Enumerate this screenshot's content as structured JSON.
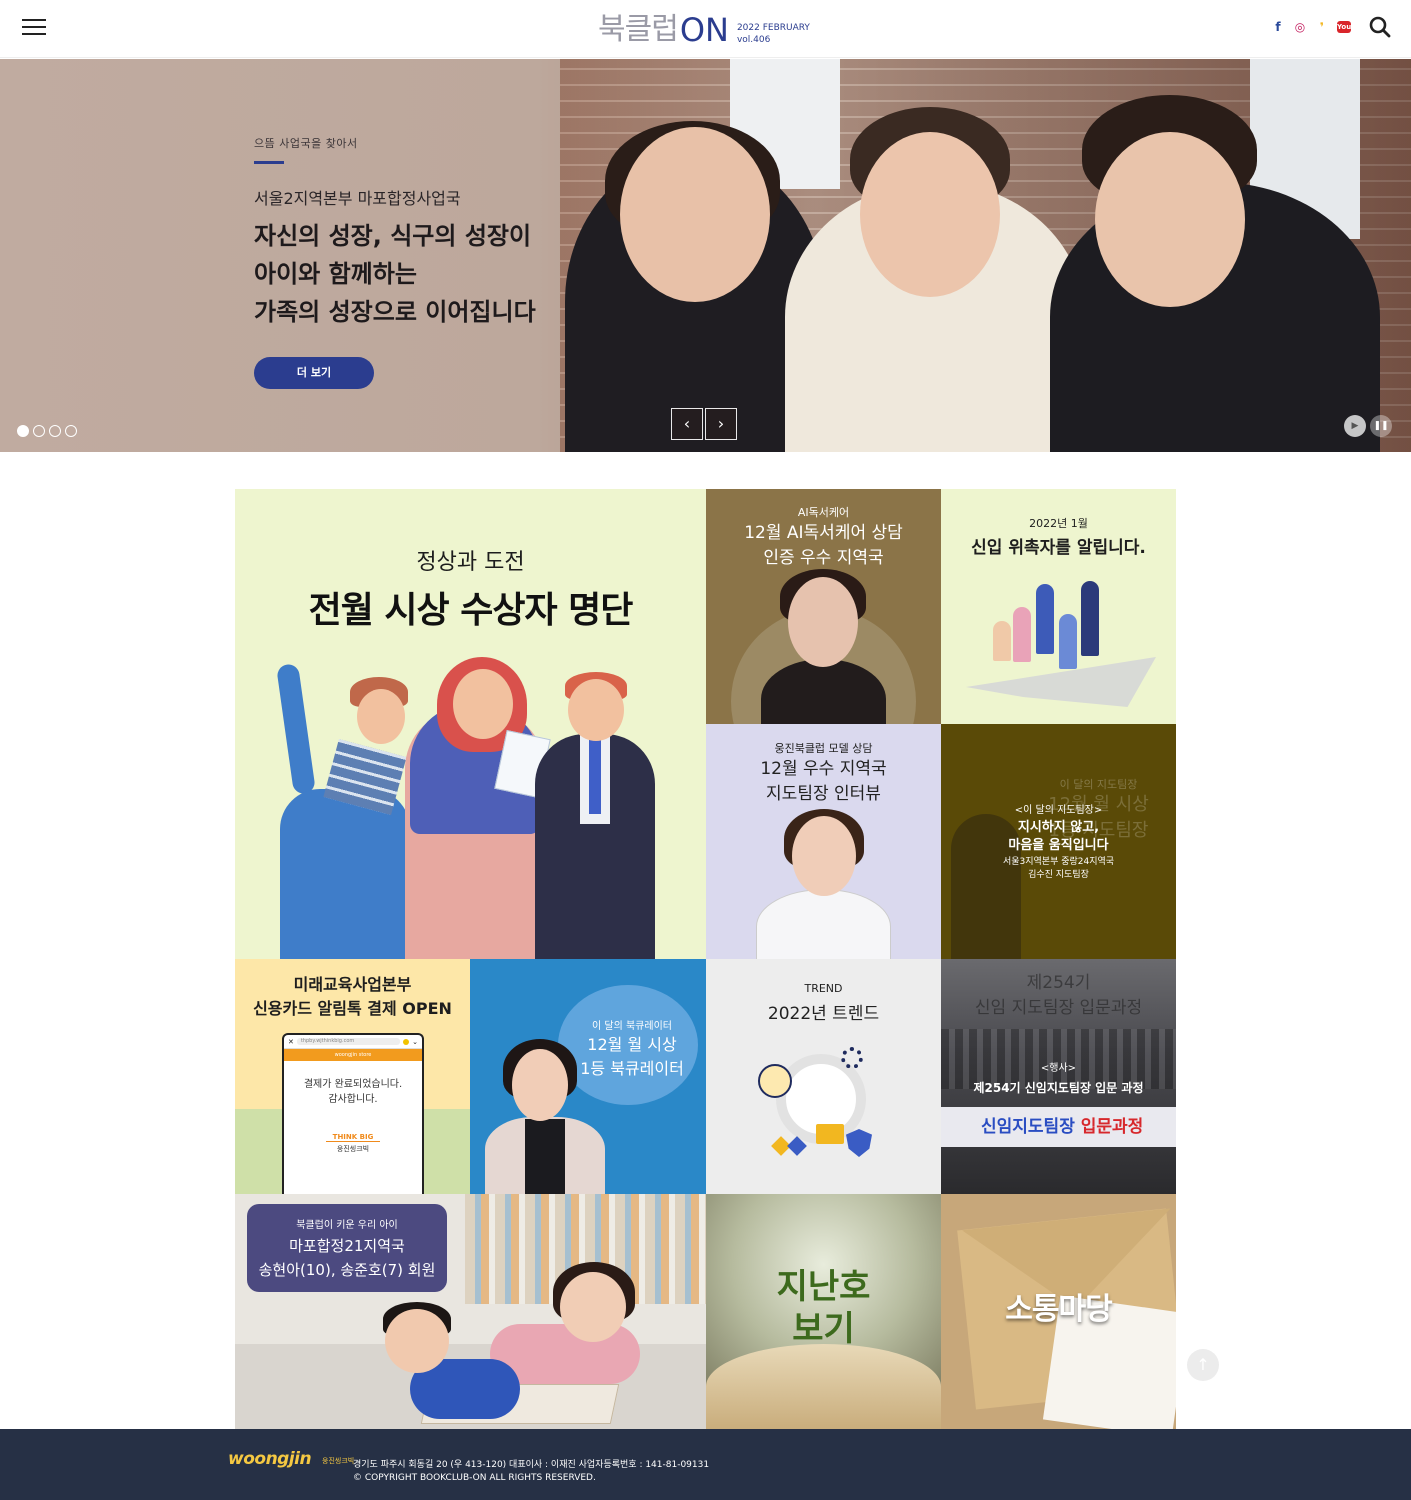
{
  "header": {
    "logo_main": "북클럽",
    "logo_on": "ON",
    "logo_date": "2022 FEBRUARY",
    "logo_vol": "vol.406",
    "sns": {
      "facebook": "f",
      "instagram": "◎",
      "kakao": "❜",
      "youtube": "You"
    }
  },
  "hero": {
    "kicker": "으뜸 사업국을 찾아서",
    "subtitle": "서울2지역본부 마포합정사업국",
    "title": "자신의 성장, 식구의 성장이\n아이와 함께하는\n가족의 성장으로 이어집니다",
    "button": "더 보기",
    "prev": "‹",
    "next": "›",
    "slides_total": 4,
    "active_slide": 1
  },
  "tiles": {
    "big": {
      "sub": "정상과 도전",
      "title": "전월 시상 수상자 명단"
    },
    "ai": {
      "kicker": "AI독서케어",
      "title": "12월 AI독서케어 상담\n인증 우수 지역국"
    },
    "recruits": {
      "kicker": "2022년 1월",
      "title": "신입 위촉자를 알립니다."
    },
    "model": {
      "kicker": "웅진북클럽 모델 상담",
      "title": "12월 우수 지역국\n지도팀장 인터뷰"
    },
    "leader": {
      "faint_kicker": "이 달의 지도팀장",
      "faint_title": "12월 월 시상\n1등 지도팀장",
      "kicker": "<이 달의 지도팀장>",
      "title": "지시하지 않고,\n마음을 움직입니다",
      "name": "서울3지역본부 중랑24지역국\n김수진 지도팀장"
    },
    "card": {
      "title": "미래교육사업본부\n신용카드 알림톡 결제 OPEN",
      "url": "thpby.wjthinkbig.com",
      "brand": "woongjin store",
      "message": "결제가 완료되었습니다.\n감사합니다.",
      "logo_a": "THINK BIG",
      "logo_b": "웅진씽크빅"
    },
    "curator": {
      "kicker": "이 달의 북큐레이터",
      "title": "12월 월 시상\n1등 북큐레이터"
    },
    "trend": {
      "kicker": "TREND",
      "title": "2022년 트렌드"
    },
    "course": {
      "faint_title": "제254기\n신임 지도팀장 입문과정",
      "kicker": "<행사>",
      "title": "제254기 신임지도팀장 입문 과정",
      "banner_a": "신임지도팀장",
      "banner_b": "입문과정"
    },
    "kids": {
      "kicker": "북클럽이 키운 우리 아이",
      "title": "마포합정21지역국\n송현아(10), 송준호(7) 회원"
    },
    "back_issue": {
      "title": "지난호\n보기"
    },
    "community": {
      "title": "소통마당"
    }
  },
  "top_button": "↑",
  "footer": {
    "logo": "woongjin",
    "logo_sub": "웅진씽크빅",
    "address": "경기도 파주시 회동길 20 (우 413-120) 대표이사 : 이재진 사업자등록번호 : 141-81-09131",
    "copyright": "© COPYRIGHT BOOKCLUB-ON ALL RIGHTS RESERVED."
  },
  "colors": {
    "brand_navy": "#2b3d8f",
    "footer_bg": "#263045",
    "tile_mint": "#eef5cf"
  }
}
